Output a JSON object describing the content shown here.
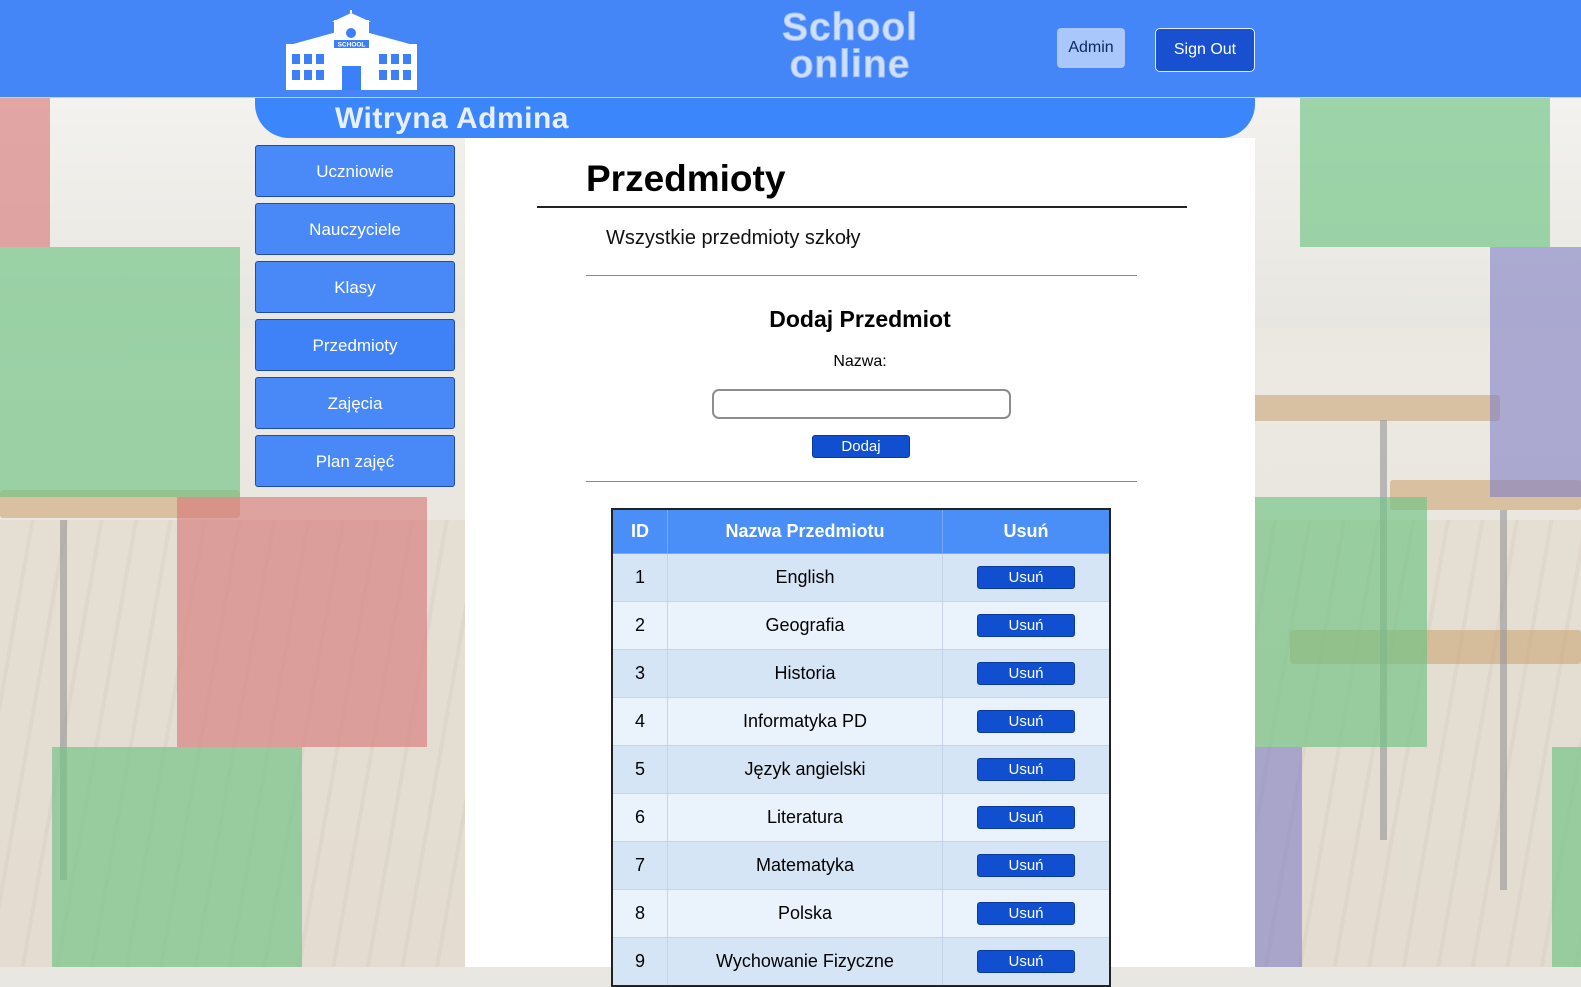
{
  "header": {
    "brand_line1": "School",
    "brand_line2": "online",
    "logo_label": "SCHOOL",
    "admin_label": "Admin",
    "signout_label": "Sign Out"
  },
  "subheader": {
    "title": "Witryna Admina"
  },
  "sidebar": {
    "items": [
      {
        "label": "Uczniowie"
      },
      {
        "label": "Nauczyciele"
      },
      {
        "label": "Klasy"
      },
      {
        "label": "Przedmioty"
      },
      {
        "label": "Zajęcia"
      },
      {
        "label": "Plan zajęć"
      }
    ]
  },
  "main": {
    "title": "Przedmioty",
    "subtitle": "Wszystkie przedmioty szkoły",
    "add_title": "Dodaj Przedmiot",
    "name_label": "Nazwa:",
    "name_value": "",
    "add_button": "Dodaj"
  },
  "table": {
    "headers": [
      "ID",
      "Nazwa Przedmiotu",
      "Usuń"
    ],
    "rows": [
      {
        "id": "1",
        "name": "English",
        "action": "Usuń"
      },
      {
        "id": "2",
        "name": "Geografia",
        "action": "Usuń"
      },
      {
        "id": "3",
        "name": "Historia",
        "action": "Usuń"
      },
      {
        "id": "4",
        "name": "Informatyka PD",
        "action": "Usuń"
      },
      {
        "id": "5",
        "name": "Język angielski",
        "action": "Usuń"
      },
      {
        "id": "6",
        "name": "Literatura",
        "action": "Usuń"
      },
      {
        "id": "7",
        "name": "Matematyka",
        "action": "Usuń"
      },
      {
        "id": "8",
        "name": "Polska",
        "action": "Usuń"
      },
      {
        "id": "9",
        "name": "Wychowanie Fizyczne",
        "action": "Usuń"
      }
    ]
  },
  "colors": {
    "header_blue": "#3b80f8",
    "button_blue": "#0f4fd0",
    "table_header": "#4a8ef7"
  }
}
